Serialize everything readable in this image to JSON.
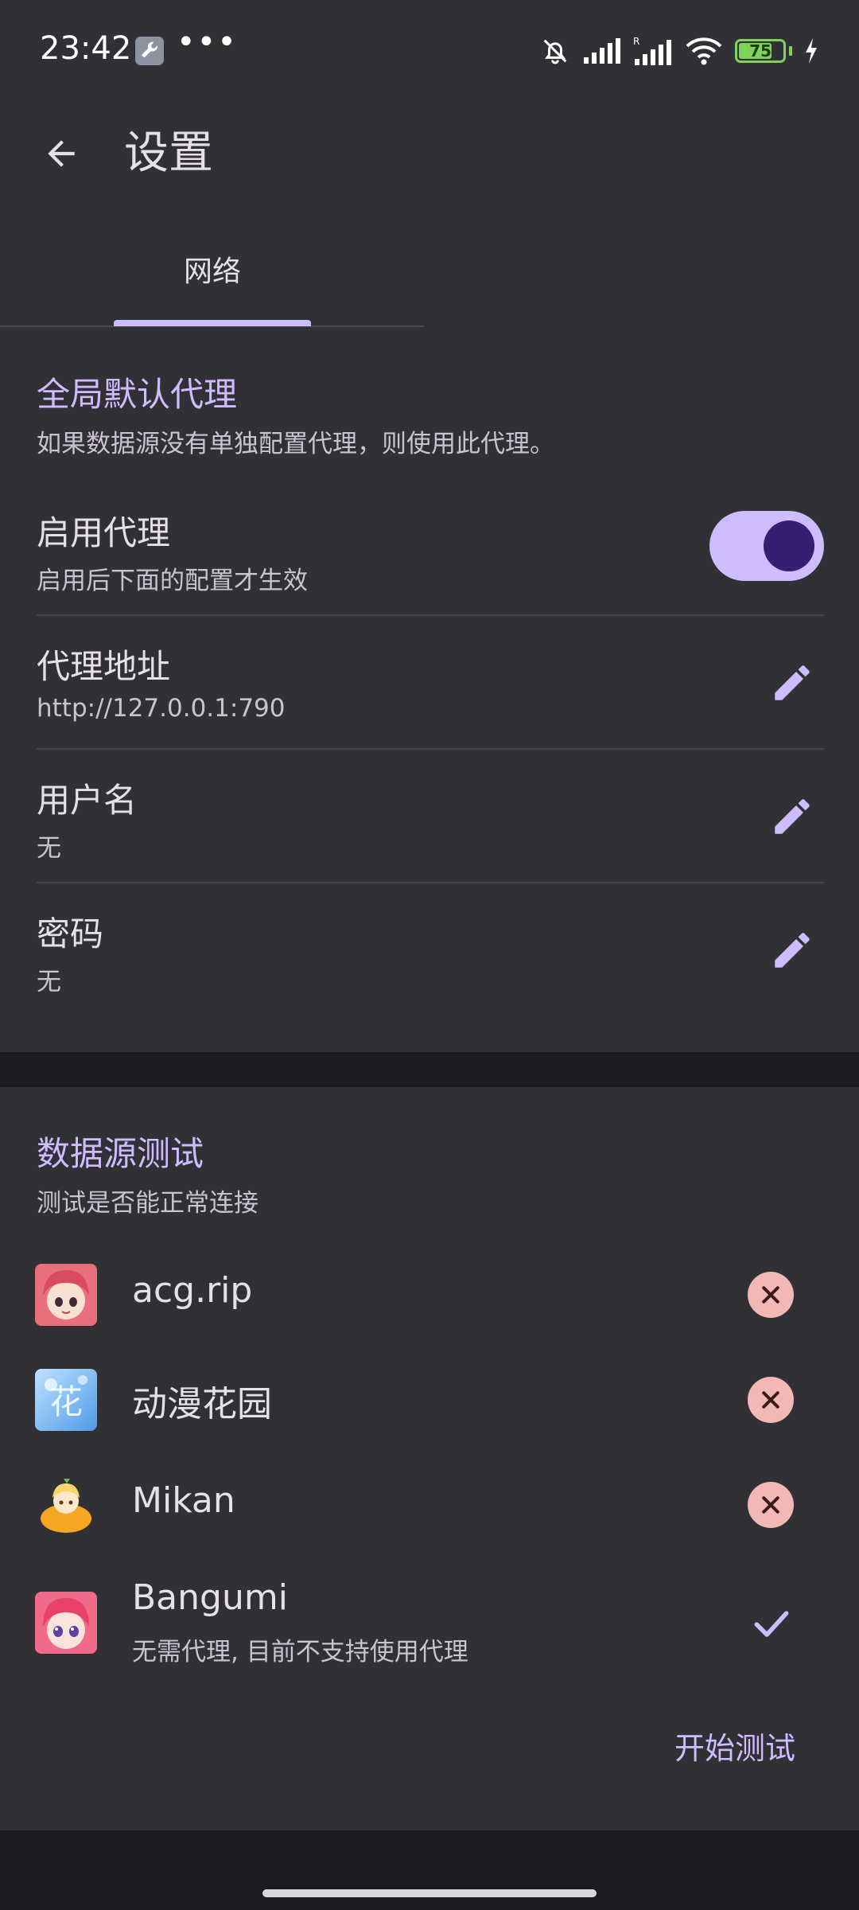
{
  "status_bar": {
    "time": "23:42",
    "dots": "•••",
    "battery_level": "75",
    "battery_fraction": 0.75,
    "icons": [
      "wrench-icon",
      "bell-off-icon",
      "signal-icon",
      "signal-roaming-icon",
      "wifi-icon",
      "battery-icon",
      "charging-icon"
    ]
  },
  "app_bar": {
    "title": "设置",
    "back_icon": "arrow-left-icon"
  },
  "tabs": [
    {
      "label": "网络",
      "selected": true
    }
  ],
  "proxy_section": {
    "title": "全局默认代理",
    "subtitle": "如果数据源没有单独配置代理，则使用此代理。",
    "enable": {
      "title": "启用代理",
      "subtitle": "启用后下面的配置才生效",
      "on": true
    },
    "address": {
      "title": "代理地址",
      "value": "http://127.0.0.1:790"
    },
    "username": {
      "title": "用户名",
      "value": "无"
    },
    "password": {
      "title": "密码",
      "value": "无"
    }
  },
  "test_section": {
    "title": "数据源测试",
    "subtitle": "测试是否能正常连接",
    "sources": [
      {
        "name": "acg.rip",
        "status": "failed",
        "status_icon": "close-circle-icon"
      },
      {
        "name": "动漫花园",
        "status": "failed",
        "status_icon": "close-circle-icon"
      },
      {
        "name": "Mikan",
        "status": "failed",
        "status_icon": "close-circle-icon"
      },
      {
        "name": "Bangumi",
        "note": "无需代理, 目前不支持使用代理",
        "status": "ok",
        "status_icon": "check-icon"
      }
    ],
    "start_button": "开始测试"
  },
  "colors": {
    "accent": "#cfbcff",
    "surface": "#313034",
    "background": "#1c1b20",
    "error_container": "#f2b8b5",
    "switch_thumb": "#381e72"
  }
}
